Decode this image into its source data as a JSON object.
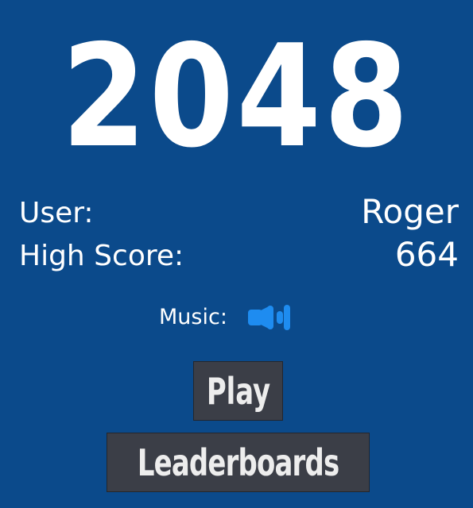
{
  "title": "2048",
  "user": {
    "label": "User:",
    "value": "Roger"
  },
  "high_score": {
    "label": "High Score:",
    "value": "664"
  },
  "music": {
    "label": "Music:",
    "icon": "speaker-icon",
    "color": "#1e8cf0"
  },
  "buttons": {
    "play": "Play",
    "leaderboards": "Leaderboards"
  },
  "colors": {
    "background": "#0b4a8b",
    "button": "#3b3e47",
    "text": "#ffffff"
  }
}
